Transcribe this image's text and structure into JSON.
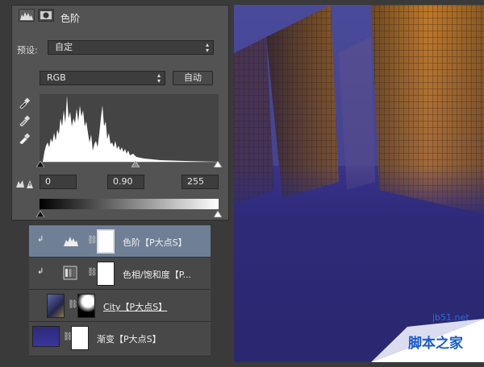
{
  "levels_panel": {
    "title": "色阶",
    "preset_label": "预设:",
    "preset_value": "自定",
    "channel_value": "RGB",
    "auto_button": "自动",
    "input_black": "0",
    "input_gamma": "0.90",
    "input_white": "255"
  },
  "layers": [
    {
      "name": "色阶【P大点S】",
      "selected": true
    },
    {
      "name": "色相/饱和度【P..."
    },
    {
      "name": "City【P大点S】"
    },
    {
      "name": "渐变【P大点S】"
    }
  ],
  "watermark": {
    "site": "jb51.net",
    "text": "脚本之家"
  },
  "colors": {
    "selected_layer": "#6f8096",
    "canvas_blue": "#2e2a78",
    "building_orange": "#c07a28"
  }
}
